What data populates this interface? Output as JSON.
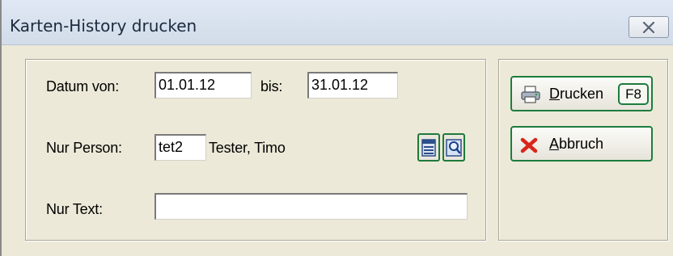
{
  "window": {
    "title": "Karten-History drucken"
  },
  "form": {
    "datum_label": "Datum  von:",
    "datum_von": "01.01.12",
    "bis_label": "bis:",
    "datum_bis": "31.01.12",
    "person_label": "Nur Person:",
    "person_code": "tet2",
    "person_name": "Tester, Timo",
    "text_label": "Nur Text:",
    "text_value": ""
  },
  "actions": {
    "print_label_underlined": "D",
    "print_label_rest": "rucken",
    "print_shortcut": "F8",
    "cancel_label_underlined": "A",
    "cancel_label_rest": "bbruch"
  },
  "icons": {
    "close": "close-icon",
    "list": "list-icon",
    "search": "magnifier-icon",
    "printer": "printer-icon",
    "cancel": "red-x-icon"
  },
  "colors": {
    "button_border": "#1d7c3e",
    "dialog_bg": "#ece9d8",
    "titlebar_bg": "#d8e1ee"
  }
}
